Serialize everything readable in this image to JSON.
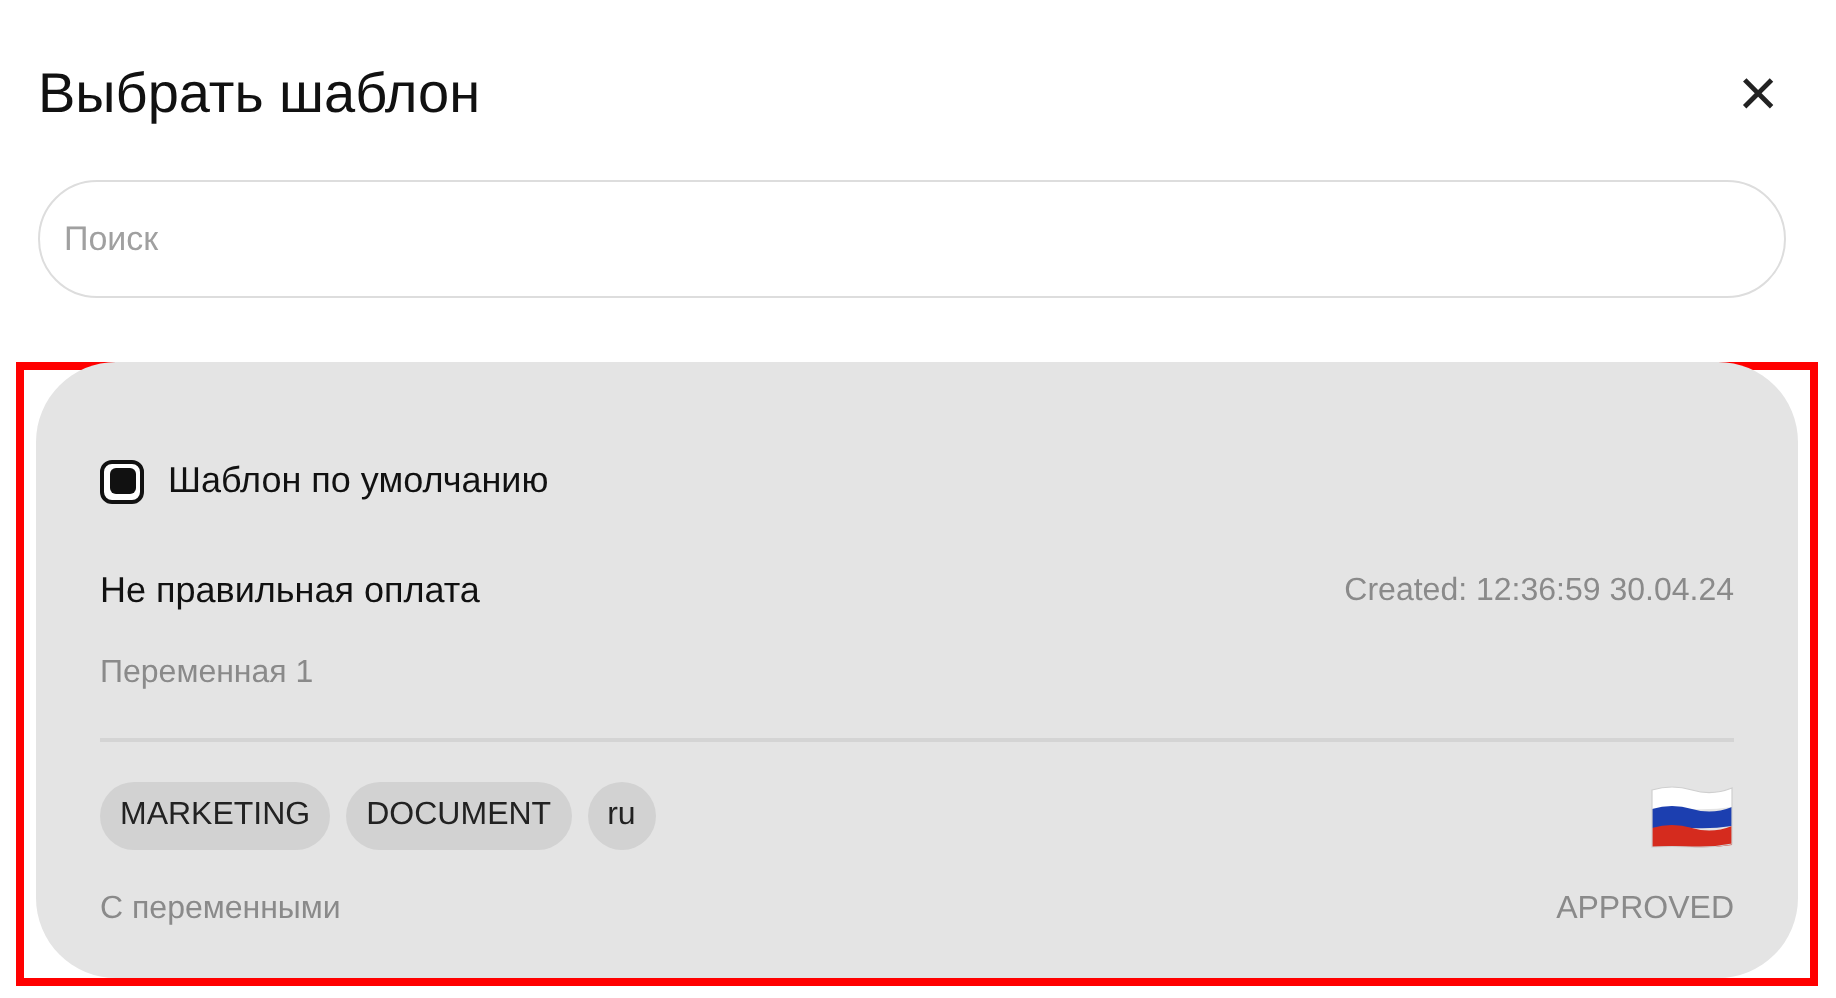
{
  "dialog": {
    "title": "Выбрать шаблон",
    "close": "×"
  },
  "search": {
    "placeholder": "Поиск"
  },
  "templates": [
    {
      "selected": true,
      "default_checked": true,
      "default_label": "Шаблон по умолчанию",
      "name": "Не правильная оплата",
      "created": "Created: 12:36:59 30.04.24",
      "variables": "Переменная 1",
      "tags": [
        "MARKETING",
        "DOCUMENT",
        "ru"
      ],
      "type": "С переменными",
      "status": "APPROVED"
    }
  ]
}
